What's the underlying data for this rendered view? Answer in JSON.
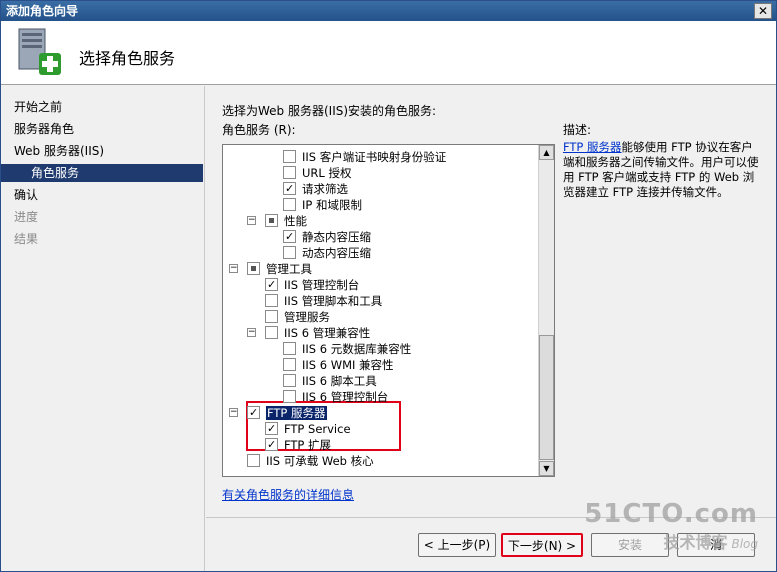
{
  "window": {
    "title": "添加角色向导",
    "close_label": "✕"
  },
  "header": {
    "title": "选择角色服务"
  },
  "nav": {
    "items": [
      {
        "label": "开始之前",
        "state": "normal"
      },
      {
        "label": "服务器角色",
        "state": "normal"
      },
      {
        "label": "Web 服务器(IIS)",
        "state": "normal"
      },
      {
        "label": "角色服务",
        "state": "selected"
      },
      {
        "label": "确认",
        "state": "normal"
      },
      {
        "label": "进度",
        "state": "disabled"
      },
      {
        "label": "结果",
        "state": "disabled"
      }
    ]
  },
  "main": {
    "instruction": "选择为Web 服务器(IIS)安装的角色服务:",
    "list_label": "角色服务 (R):",
    "tree": [
      {
        "label": "IIS 客户端证书映射身份验证",
        "level": 3,
        "check": "unchecked",
        "expander": null
      },
      {
        "label": "URL 授权",
        "level": 3,
        "check": "unchecked",
        "expander": null
      },
      {
        "label": "请求筛选",
        "level": 3,
        "check": "checked",
        "expander": null
      },
      {
        "label": "IP 和域限制",
        "level": 3,
        "check": "unchecked",
        "expander": null
      },
      {
        "label": "性能",
        "level": 2,
        "check": "partial",
        "expander": "−"
      },
      {
        "label": "静态内容压缩",
        "level": 3,
        "check": "checked",
        "expander": null
      },
      {
        "label": "动态内容压缩",
        "level": 3,
        "check": "unchecked",
        "expander": null
      },
      {
        "label": "管理工具",
        "level": 1,
        "check": "partial",
        "expander": "−"
      },
      {
        "label": "IIS 管理控制台",
        "level": 2,
        "check": "checked",
        "expander": null
      },
      {
        "label": "IIS 管理脚本和工具",
        "level": 2,
        "check": "unchecked",
        "expander": null
      },
      {
        "label": "管理服务",
        "level": 2,
        "check": "unchecked",
        "expander": null
      },
      {
        "label": "IIS 6 管理兼容性",
        "level": 2,
        "check": "unchecked",
        "expander": "−"
      },
      {
        "label": "IIS 6 元数据库兼容性",
        "level": 3,
        "check": "unchecked",
        "expander": null
      },
      {
        "label": "IIS 6 WMI 兼容性",
        "level": 3,
        "check": "unchecked",
        "expander": null
      },
      {
        "label": "IIS 6 脚本工具",
        "level": 3,
        "check": "unchecked",
        "expander": null
      },
      {
        "label": "IIS 6 管理控制台",
        "level": 3,
        "check": "unchecked",
        "expander": null
      },
      {
        "label": "FTP 服务器",
        "level": 1,
        "check": "checked",
        "expander": "−",
        "selected": true
      },
      {
        "label": "FTP Service",
        "level": 2,
        "check": "checked",
        "expander": null
      },
      {
        "label": "FTP 扩展",
        "level": 2,
        "check": "checked",
        "expander": null
      },
      {
        "label": "IIS 可承载 Web 核心",
        "level": 1,
        "check": "unchecked",
        "expander": null
      }
    ],
    "more_info_link": "有关角色服务的详细信息"
  },
  "description": {
    "label": "描述:",
    "link": "FTP 服务器",
    "text": "能够使用 FTP 协议在客户端和服务器之间传输文件。用户可以使用 FTP 客户端或支持 FTP 的 Web 浏览器建立 FTP 连接并传输文件。"
  },
  "buttons": {
    "prev": "< 上一步(P)",
    "next": "下一步(N) >",
    "install": "安装",
    "cancel": "消"
  },
  "watermark": {
    "line1": "51CTO.com",
    "line2": "技术博客",
    "line3": "Blog"
  }
}
